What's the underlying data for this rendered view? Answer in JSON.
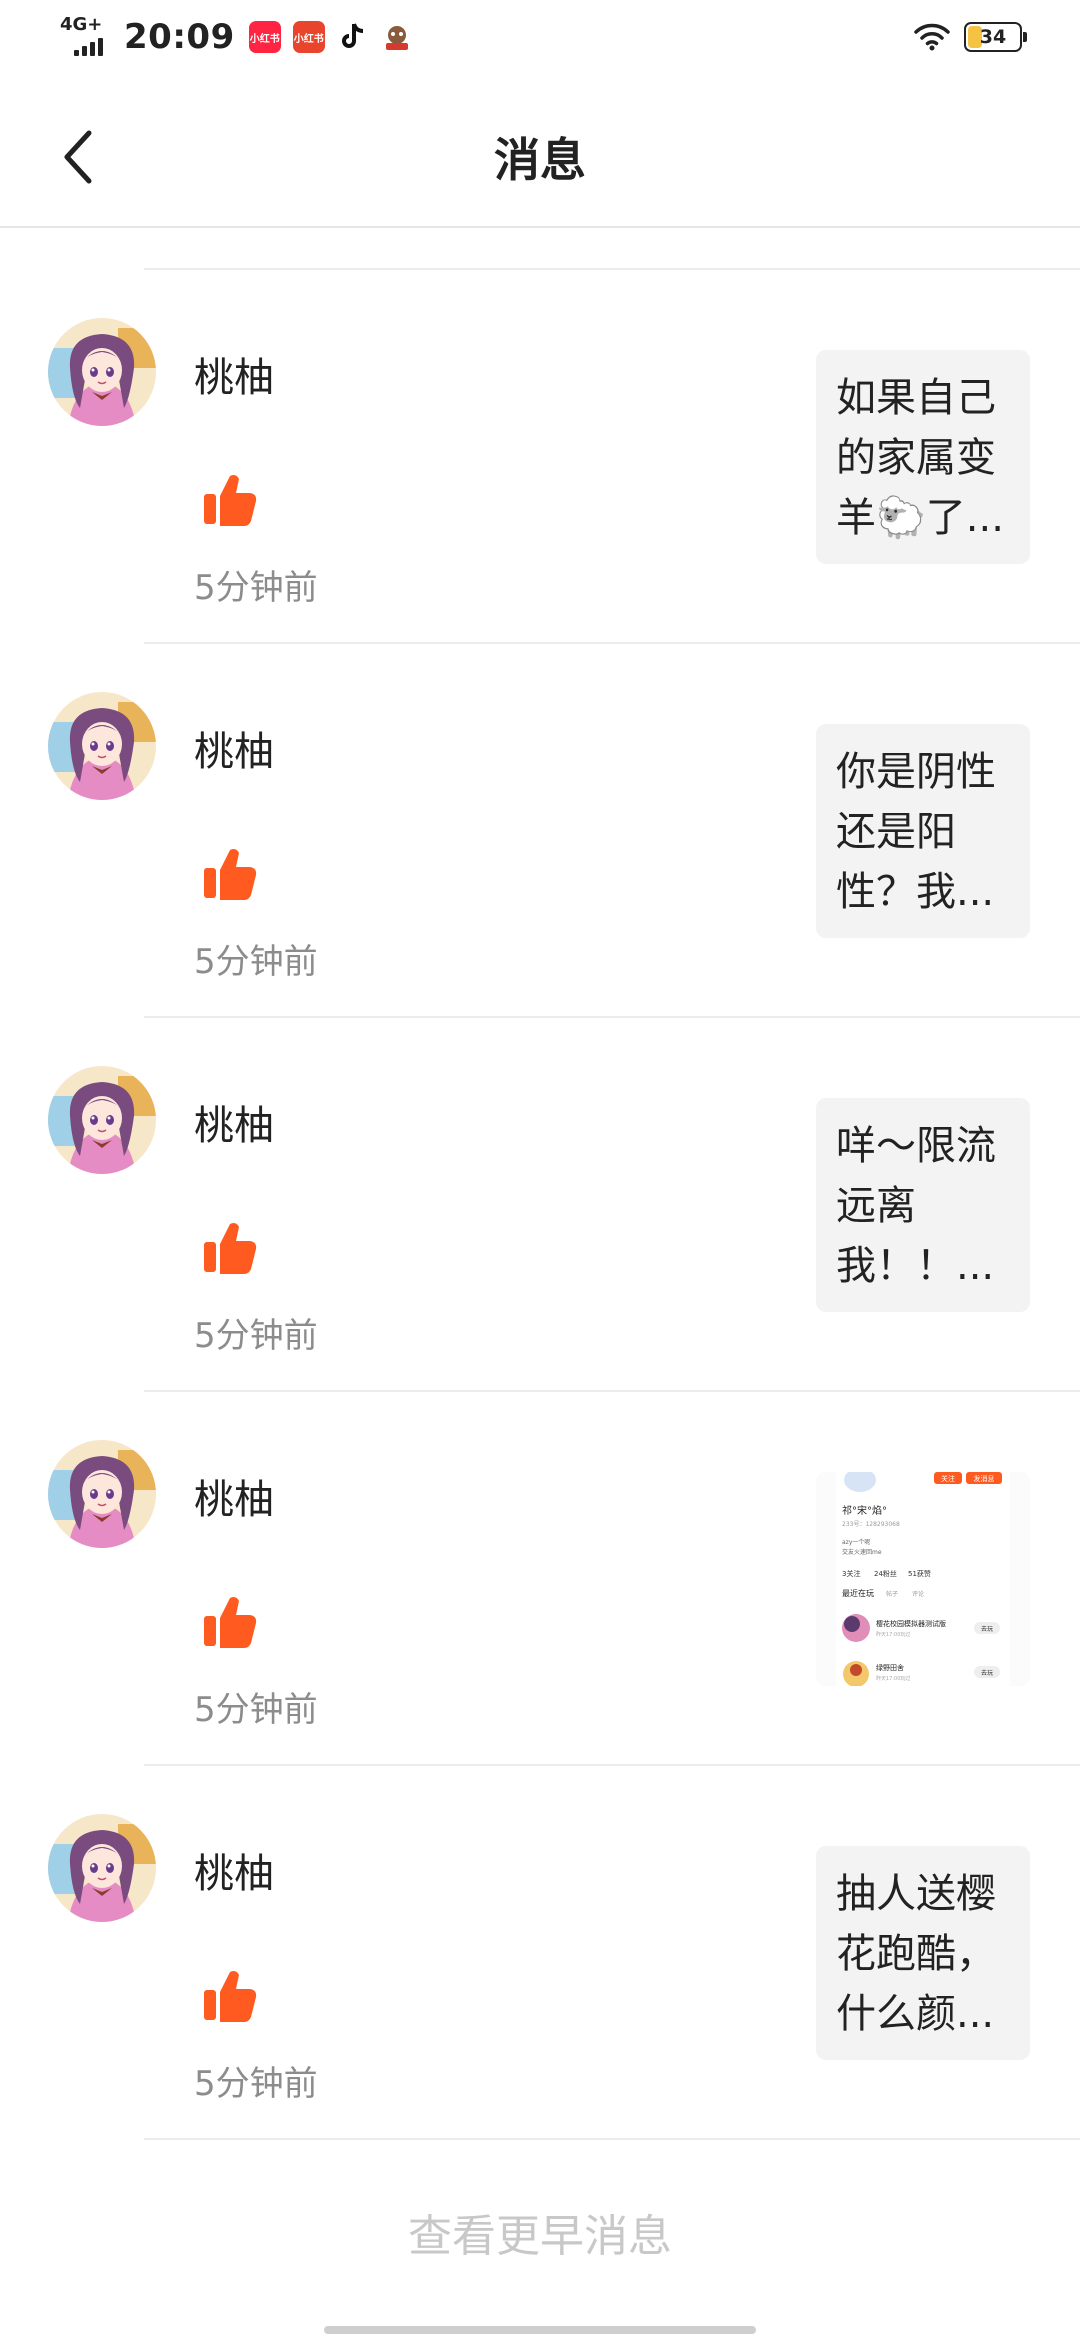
{
  "status_bar": {
    "network": "4G+",
    "time": "20:09",
    "apps": [
      {
        "name": "xiaohongshu-app-icon",
        "label": "小红书",
        "color": "#ff2442"
      },
      {
        "name": "xiaohongshu-alt-app-icon",
        "label": "小红书",
        "color": "#e8452c"
      },
      {
        "name": "tiktok-app-icon",
        "label": "",
        "color": "#111111"
      },
      {
        "name": "game-app-icon",
        "label": "",
        "color": "#c0392b"
      }
    ],
    "battery_percent": "34"
  },
  "header": {
    "title": "消息",
    "back_icon": "chevron-left-icon"
  },
  "messages": [
    {
      "username": "桃柚",
      "action_icon": "thumbs-up-icon",
      "time": "5分钟前",
      "preview_type": "text",
      "preview_text": "如果自己的家属变羊🐑了..."
    },
    {
      "username": "桃柚",
      "action_icon": "thumbs-up-icon",
      "time": "5分钟前",
      "preview_type": "text",
      "preview_text": "你是阴性还是阳性？我..."
    },
    {
      "username": "桃柚",
      "action_icon": "thumbs-up-icon",
      "time": "5分钟前",
      "preview_type": "text",
      "preview_text": "咩～限流远离我！！..."
    },
    {
      "username": "桃柚",
      "action_icon": "thumbs-up-icon",
      "time": "5分钟前",
      "preview_type": "image",
      "preview_text": ""
    },
    {
      "username": "桃柚",
      "action_icon": "thumbs-up-icon",
      "time": "5分钟前",
      "preview_type": "text",
      "preview_text": "抽人送樱花跑酷，什么颜..."
    }
  ],
  "thumbnail": {
    "follow_label": "关注",
    "message_label": "发消息",
    "nickname": "祁°宋°焰°",
    "id_line": "233号：128293068",
    "bio_1": "azy一个呢",
    "bio_2": "交友火速回me",
    "stat_1": "3关注",
    "stat_2": "24粉丝",
    "stat_3": "51获赞",
    "section_title": "最近在玩",
    "tab_2": "帖子",
    "tab_3": "评论",
    "game_1_title": "樱花校园模拟器测试版",
    "game_1_sub": "昨天17:00玩过",
    "game_2_title": "绿野田舍",
    "game_2_sub": "昨天17:00玩过",
    "play_label": "去玩"
  },
  "footer": {
    "load_more": "查看更早消息"
  },
  "colors": {
    "like": "#ff5a1f",
    "divider": "#ececec",
    "muted": "#8c8c8c",
    "preview_bg": "#f3f3f3",
    "battery": "#f5c242"
  }
}
